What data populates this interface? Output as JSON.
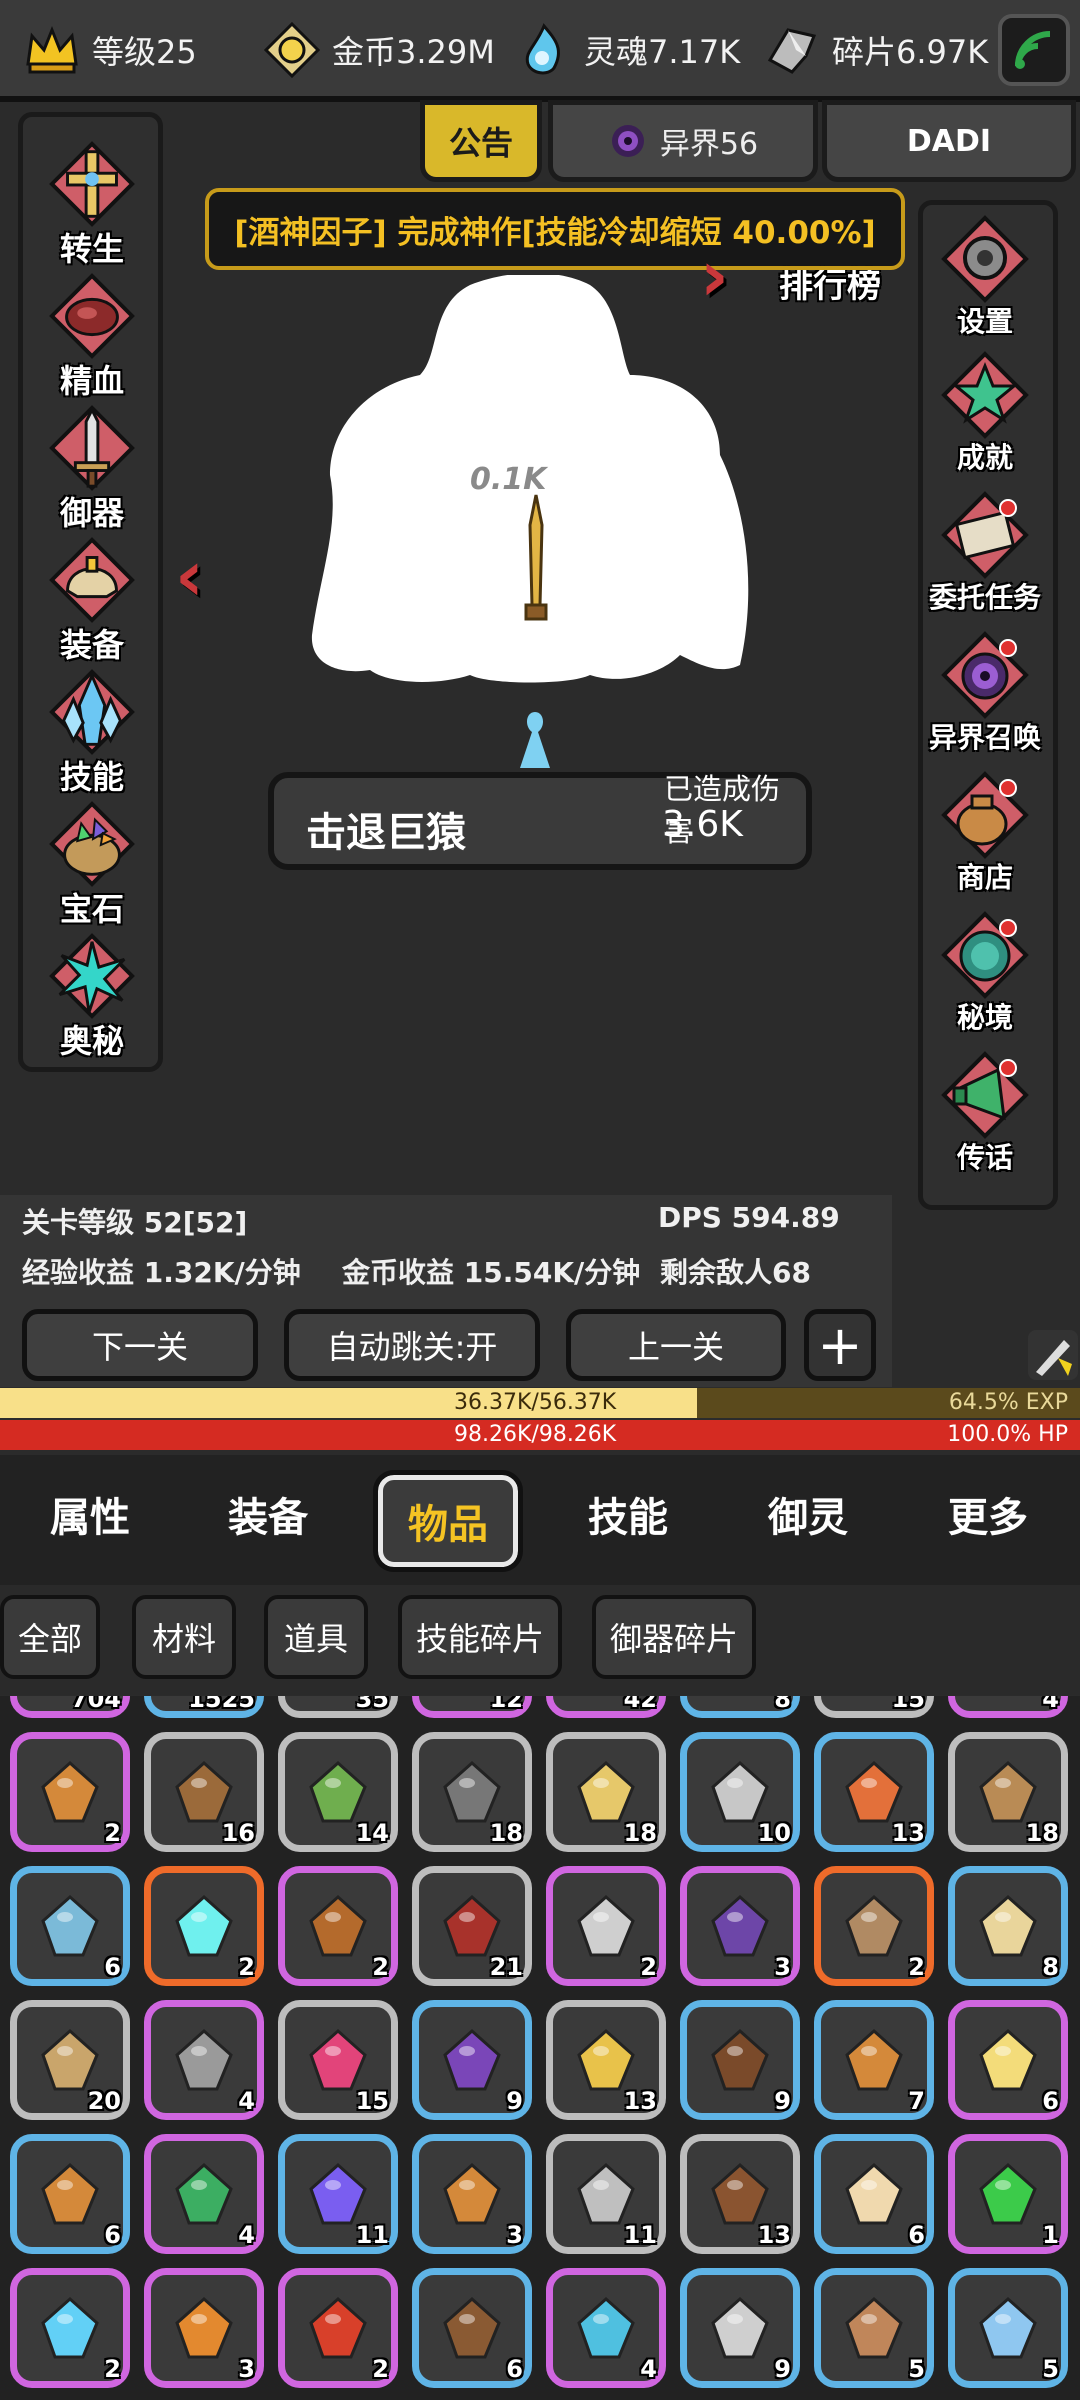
{
  "topbar": {
    "level": "等级25",
    "gold": "金币3.29M",
    "soul": "灵魂7.17K",
    "shards": "碎片6.97K"
  },
  "tabs": {
    "notice": "公告",
    "otherworld": "异界56",
    "player": "DADI"
  },
  "banner": "[酒神因子] 完成神作[技能冷却缩短 40.00%]",
  "left_menu": [
    "转生",
    "精血",
    "御器",
    "装备",
    "技能",
    "宝石",
    "奥秘"
  ],
  "right_menu": [
    "设置",
    "成就",
    "委托任务",
    "异界召唤",
    "商店",
    "秘境",
    "传话"
  ],
  "ranking": "排行榜",
  "boss": {
    "hp_label": "0.1K"
  },
  "battle": {
    "title": "击退巨猿",
    "dmg_label": "已造成伤害",
    "dmg_value": "3.6K"
  },
  "stats": {
    "stage": "关卡等级 52[52]",
    "dps": "DPS 594.89",
    "exp_rate": "经验收益 1.32K/分钟",
    "gold_rate": "金币收益 15.54K/分钟",
    "enemies": "剩余敌人68"
  },
  "buttons": {
    "next": "下一关",
    "auto": "自动跳关:开",
    "prev": "上一关",
    "plus": "+"
  },
  "exp": {
    "text": "36.37K/56.37K",
    "percent_text": "64.5% EXP",
    "fraction": 0.645
  },
  "hp": {
    "text": "98.26K/98.26K",
    "percent_text": "100.0%  HP",
    "fraction": 1.0
  },
  "nav": [
    "属性",
    "装备",
    "物品",
    "技能",
    "御灵",
    "更多"
  ],
  "subnav": [
    "全部",
    "材料",
    "道具",
    "技能碎片",
    "御器碎片"
  ],
  "partial_row_counts": [
    "704",
    "1525",
    "35",
    "12",
    "42",
    "8",
    "15",
    "4"
  ],
  "items": [
    {
      "c": "purple",
      "n": "2",
      "icon": "puzzle-piece-icon"
    },
    {
      "c": "white",
      "n": "16",
      "icon": "bow-icon"
    },
    {
      "c": "white",
      "n": "14",
      "icon": "sapling-icon"
    },
    {
      "c": "white",
      "n": "18",
      "icon": "bead-necklace-icon"
    },
    {
      "c": "white",
      "n": "18",
      "icon": "sword-icon"
    },
    {
      "c": "blue",
      "n": "10",
      "icon": "dagger-icon"
    },
    {
      "c": "blue",
      "n": "13",
      "icon": "pendant-icon"
    },
    {
      "c": "white",
      "n": "18",
      "icon": "wood-plank-icon"
    },
    {
      "c": "blue",
      "n": "6",
      "icon": "orb-icon"
    },
    {
      "c": "orange",
      "n": "2",
      "icon": "crystal-icon"
    },
    {
      "c": "purple",
      "n": "2",
      "icon": "boot-icon"
    },
    {
      "c": "white",
      "n": "21",
      "icon": "cloak-icon"
    },
    {
      "c": "purple",
      "n": "2",
      "icon": "armor-suit-icon"
    },
    {
      "c": "purple",
      "n": "3",
      "icon": "book-icon"
    },
    {
      "c": "orange",
      "n": "2",
      "icon": "spear-icon"
    },
    {
      "c": "blue",
      "n": "8",
      "icon": "clock-icon"
    },
    {
      "c": "white",
      "n": "20",
      "icon": "harp-bow-icon"
    },
    {
      "c": "purple",
      "n": "4",
      "icon": "crossed-weapons-icon"
    },
    {
      "c": "white",
      "n": "15",
      "icon": "pink-gem-icon"
    },
    {
      "c": "blue",
      "n": "9",
      "icon": "potion-vial-icon"
    },
    {
      "c": "white",
      "n": "13",
      "icon": "bell-icon"
    },
    {
      "c": "blue",
      "n": "9",
      "icon": "belt-icon"
    },
    {
      "c": "blue",
      "n": "7",
      "icon": "puzzle-piece-icon"
    },
    {
      "c": "purple",
      "n": "6",
      "icon": "flame-drop-icon"
    },
    {
      "c": "blue",
      "n": "6",
      "icon": "puzzle-piece-icon"
    },
    {
      "c": "purple",
      "n": "4",
      "icon": "clover-icon"
    },
    {
      "c": "blue",
      "n": "11",
      "icon": "diamond-icon"
    },
    {
      "c": "blue",
      "n": "3",
      "icon": "puzzle-piece-icon"
    },
    {
      "c": "white",
      "n": "11",
      "icon": "tripod-icon"
    },
    {
      "c": "white",
      "n": "13",
      "icon": "potted-plant-icon"
    },
    {
      "c": "blue",
      "n": "6",
      "icon": "flask-icon"
    },
    {
      "c": "purple",
      "n": "1",
      "icon": "green-essence-icon"
    },
    {
      "c": "purple",
      "n": "2",
      "icon": "ice-essence-icon"
    },
    {
      "c": "purple",
      "n": "3",
      "icon": "ball-icon"
    },
    {
      "c": "purple",
      "n": "2",
      "icon": "fire-icon"
    },
    {
      "c": "blue",
      "n": "6",
      "icon": "pipe-icon"
    },
    {
      "c": "purple",
      "n": "4",
      "icon": "scepter-icon"
    },
    {
      "c": "blue",
      "n": "9",
      "icon": "axe-icon"
    },
    {
      "c": "blue",
      "n": "5",
      "icon": "rope-coil-icon"
    },
    {
      "c": "blue",
      "n": "5",
      "icon": "blue-vase-icon"
    }
  ]
}
